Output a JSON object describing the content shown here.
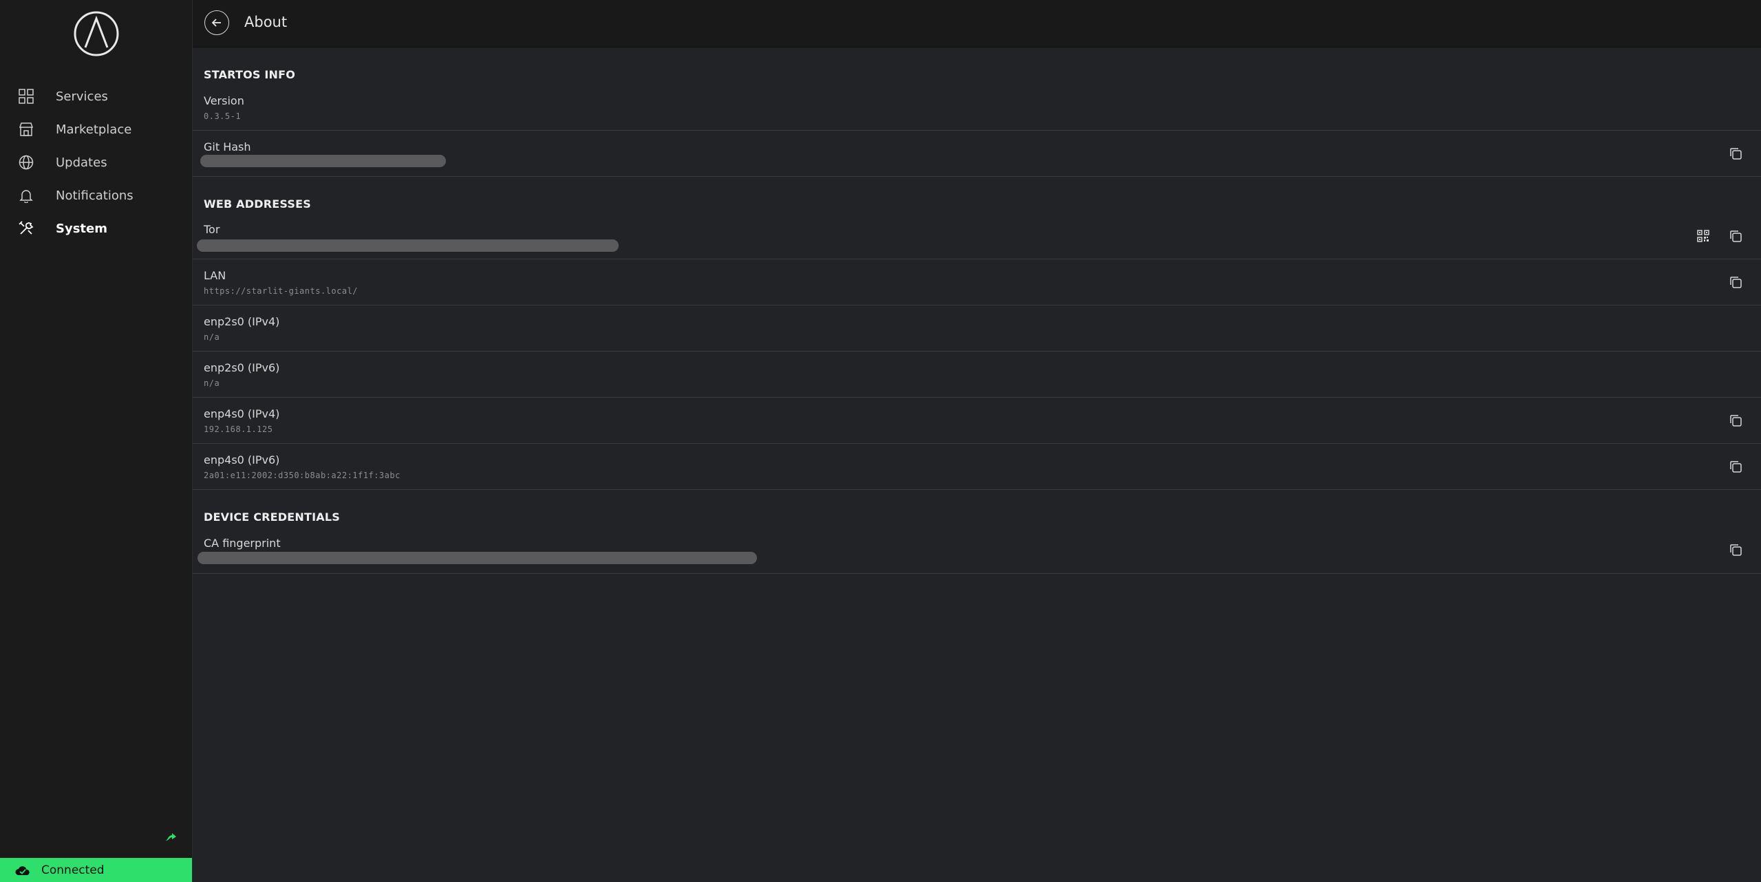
{
  "sidebar": {
    "items": [
      {
        "label": "Services",
        "icon": "grid-icon"
      },
      {
        "label": "Marketplace",
        "icon": "storefront-icon"
      },
      {
        "label": "Updates",
        "icon": "globe-icon"
      },
      {
        "label": "Notifications",
        "icon": "bell-icon"
      },
      {
        "label": "System",
        "icon": "tools-icon",
        "active": true
      }
    ],
    "status": {
      "label": "Connected",
      "color": "#2ee06b"
    }
  },
  "header": {
    "title": "About"
  },
  "sections": {
    "startos_info": {
      "title": "STARTOS INFO",
      "version": {
        "label": "Version",
        "value": "0.3.5-1"
      },
      "git_hash": {
        "label": "Git Hash"
      }
    },
    "web_addresses": {
      "title": "WEB ADDRESSES",
      "tor": {
        "label": "Tor"
      },
      "lan": {
        "label": "LAN",
        "value": "https://starlit-giants.local/"
      },
      "enp2s0_ipv4": {
        "label": "enp2s0 (IPv4)",
        "value": "n/a"
      },
      "enp2s0_ipv6": {
        "label": "enp2s0 (IPv6)",
        "value": "n/a"
      },
      "enp4s0_ipv4": {
        "label": "enp4s0 (IPv4)",
        "value": "192.168.1.125"
      },
      "enp4s0_ipv6": {
        "label": "enp4s0 (IPv6)",
        "value": "2a01:e11:2002:d350:b8ab:a22:1f1f:3abc"
      }
    },
    "device_credentials": {
      "title": "DEVICE CREDENTIALS",
      "ca_fingerprint": {
        "label": "CA fingerprint"
      }
    }
  }
}
